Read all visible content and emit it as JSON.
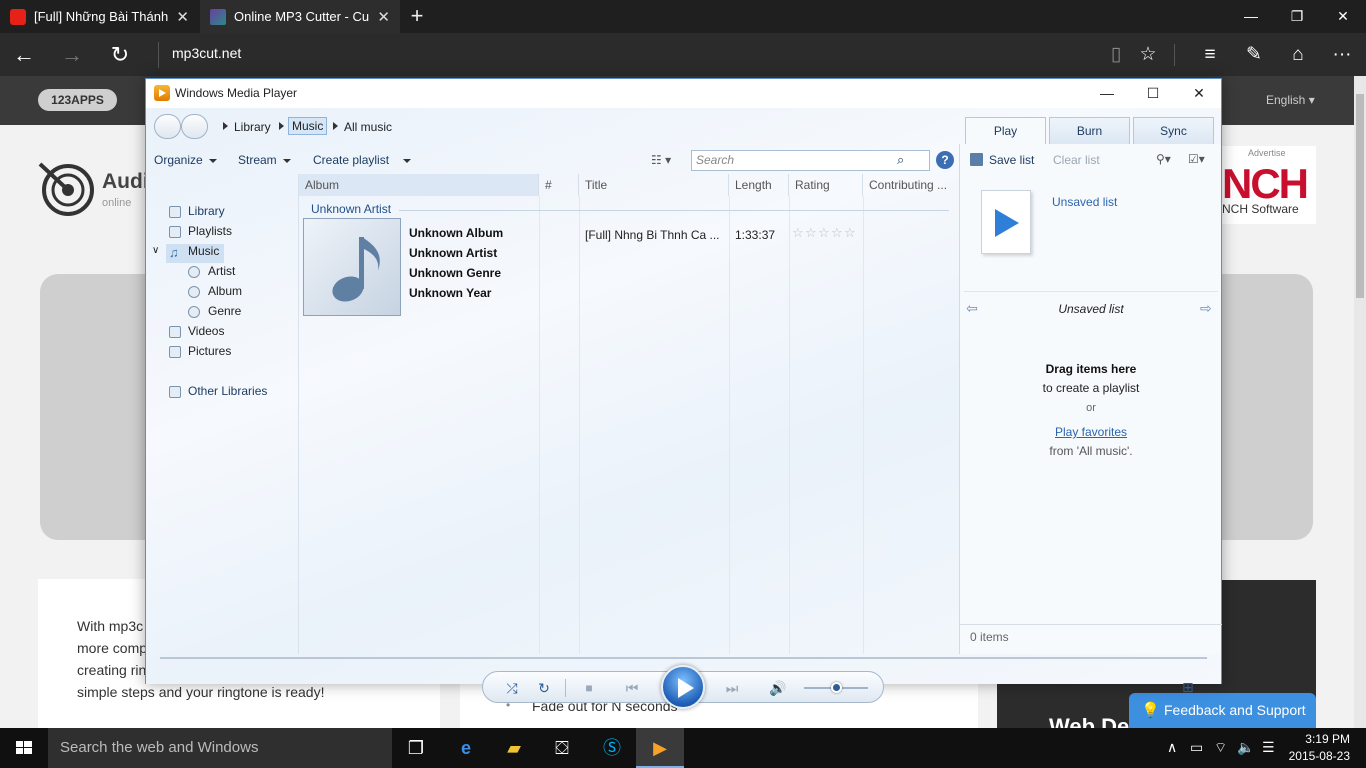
{
  "browser": {
    "tabs": [
      {
        "title": "[Full] Những Bài Thánh Ca",
        "close": "✕"
      },
      {
        "title": "Online MP3 Cutter - Cut",
        "close": "✕"
      }
    ],
    "new_tab": "+",
    "window_controls": {
      "minimize": "—",
      "maximize": "❐",
      "close": "✕"
    },
    "nav": {
      "back": "←",
      "forward": "→",
      "refresh": "↻"
    },
    "url": "mp3cut.net",
    "toolbar_icons": {
      "reading": "▯",
      "favorite": "☆",
      "hub": "≡",
      "note": "✎",
      "share": "⌂",
      "more": "···"
    }
  },
  "webpage": {
    "brand": "123APPS",
    "language": "English ▾",
    "app_title": "Audi",
    "app_subtitle": "online",
    "ad_nch": "NCH",
    "ad_software": "NCH Software",
    "ad_label": "Advertise",
    "card_text": "With mp3c\nmore comp\ncreating rin\nsimple steps and your ringtone is ready!",
    "list_bullet": "•",
    "list_item": "Fade out for N seconds",
    "ad2_text": "Web De",
    "feedback": "Feedback and Support"
  },
  "wmp": {
    "title": "Windows Media Player",
    "controls": {
      "minimize": "—",
      "maximize": "☐",
      "close": "✕"
    },
    "breadcrumb": [
      "Library",
      "Music",
      "All music"
    ],
    "tabs": [
      "Play",
      "Burn",
      "Sync"
    ],
    "toolbar": {
      "organize": "Organize",
      "stream": "Stream",
      "create_playlist": "Create playlist"
    },
    "search_placeholder": "Search",
    "help": "?",
    "nav": {
      "library": "Library",
      "playlists": "Playlists",
      "music": "Music",
      "artist": "Artist",
      "album": "Album",
      "genre": "Genre",
      "videos": "Videos",
      "pictures": "Pictures",
      "other_libraries": "Other Libraries"
    },
    "columns": [
      "Album",
      "#",
      "Title",
      "Length",
      "Rating",
      "Contributing ..."
    ],
    "group_header": "Unknown Artist",
    "album_info": [
      "Unknown Album",
      "Unknown Artist",
      "Unknown Genre",
      "Unknown Year"
    ],
    "track": {
      "title": "[Full] Nhng Bi Thnh Ca ...",
      "length": "1:33:37",
      "rating_stars": 5,
      "rating_value": 0
    },
    "list_pane": {
      "save_list": "Save list",
      "clear_list": "Clear list",
      "unsaved_list": "Unsaved list",
      "drag_title": "Drag items here",
      "drag_sub": "to create a playlist",
      "or": "or",
      "play_favorites": "Play favorites",
      "from": "from 'All music'.",
      "items": "0 items"
    },
    "transport": {
      "shuffle": "⤮",
      "repeat": "↻",
      "stop": "■",
      "prev": "⏮",
      "next": "⏭",
      "volume": "🔊"
    },
    "volume_level": 0.5
  },
  "taskbar": {
    "search": "Search the web and Windows",
    "time": "3:19 PM",
    "date": "2015-08-23"
  },
  "colors": {
    "accent": "#2b5d98",
    "link": "#2a64b0",
    "browser_bg": "#1f1f1f"
  }
}
